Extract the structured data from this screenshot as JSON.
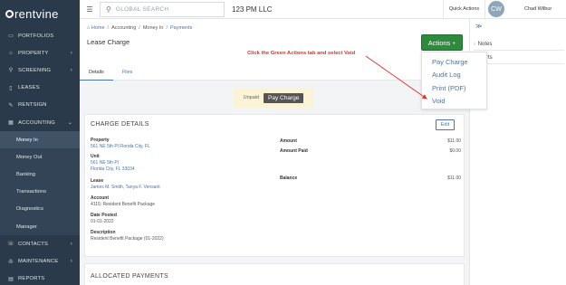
{
  "brand": {
    "logo_text": "rentvine"
  },
  "sidebar": {
    "items": [
      {
        "icon": "folder-icon",
        "glyph": "▭",
        "label": "PORTFOLIOS",
        "chevron": false
      },
      {
        "icon": "home-icon",
        "glyph": "⌂",
        "label": "PROPERTY",
        "chevron": true
      },
      {
        "icon": "search-icon",
        "glyph": "⚲",
        "label": "SCREENING",
        "chevron": true
      },
      {
        "icon": "file-icon",
        "glyph": "▯",
        "label": "LEASES",
        "chevron": false
      },
      {
        "icon": "sign-icon",
        "glyph": "✎",
        "label": "RENTSIGN",
        "chevron": false
      },
      {
        "icon": "calculator-icon",
        "glyph": "▦",
        "label": "ACCOUNTING",
        "chevron": true,
        "expanded": true
      }
    ],
    "sub_items": [
      {
        "label": "Money In",
        "active": true
      },
      {
        "label": "Money Out",
        "active": false
      },
      {
        "label": "Banking",
        "active": false
      },
      {
        "label": "Transactions",
        "active": false
      },
      {
        "label": "Diagnostics",
        "active": false
      },
      {
        "label": "Manager",
        "active": false
      }
    ],
    "bottom_items": [
      {
        "icon": "contacts-icon",
        "glyph": "☏",
        "label": "CONTACTS",
        "chevron": true
      },
      {
        "icon": "wrench-icon",
        "glyph": "✇",
        "label": "MAINTENANCE",
        "chevron": true
      },
      {
        "icon": "chart-icon",
        "glyph": "▤",
        "label": "REPORTS",
        "chevron": false
      }
    ]
  },
  "topbar": {
    "search_placeholder": "GLOBAL SEARCH",
    "company": "123 PM LLC",
    "quick_actions": "Quick Actions",
    "avatar_initials": "CW",
    "user_name": "Chad Wilbur"
  },
  "breadcrumb": {
    "home": "Home",
    "items": [
      "Accounting",
      "Money In"
    ],
    "current": "Payments"
  },
  "page": {
    "title": "Lease Charge",
    "actions_label": "Actions"
  },
  "annotation": "Click the Green Actions tab and select Void",
  "tabs": [
    {
      "label": "Details",
      "active": true
    },
    {
      "label": "Files",
      "active": false
    }
  ],
  "dropdown": [
    "Pay Charge",
    "Audit Log",
    "Print (PDF)",
    "Void"
  ],
  "status": {
    "label": "Unpaid",
    "button": "Pay Charge"
  },
  "charge_details": {
    "title": "CHARGE DETAILS",
    "edit": "Edit",
    "property_label": "Property",
    "property_value": "561 NE 5th Pl Florida City, FL",
    "unit_label": "Unit",
    "unit_line1": "561 NE 5th Pl",
    "unit_line2": "Florida City, FL 33034",
    "lease_label": "Lease",
    "lease_value": "James M. Smith, Tanya F. Vensant",
    "account_label": "Account",
    "account_value": "4115: Resident Benefit Package",
    "date_label": "Date Posted",
    "date_value": "01-01-2022",
    "desc_label": "Description",
    "desc_value": "Resident Benefit Package (01-2022)",
    "amount_label": "Amount",
    "amount_value": "$11.00",
    "amount_paid_label": "Amount Paid",
    "amount_paid_value": "$0.00",
    "balance_label": "Balance",
    "balance_value": "$11.00"
  },
  "allocated": {
    "title": "ALLOCATED PAYMENTS"
  },
  "right_panel": {
    "collapse": "≫",
    "notes": "Notes",
    "second": "rts"
  },
  "colors": {
    "sidebar": "#2b3a4a",
    "actions_green": "#2e8b3e",
    "link_blue": "#4a74a6",
    "annotation_red": "#e0312b",
    "pending_yellow": "#fbf3d5"
  }
}
